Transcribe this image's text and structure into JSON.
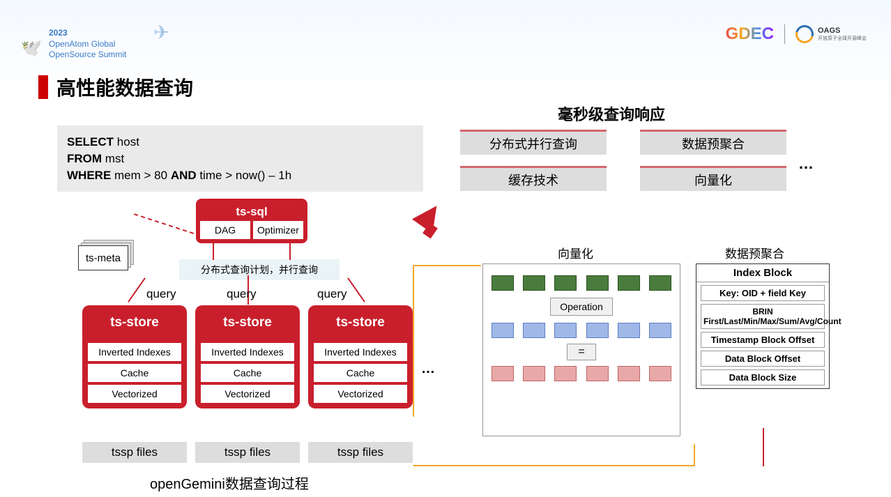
{
  "header": {
    "year": "2023",
    "line1": "OpenAtom Global",
    "line2": "OpenSource Summit"
  },
  "logos": {
    "gdec": "GDEC",
    "oags": "OAGS",
    "oags_sub": "开放原子全球开源峰会"
  },
  "title": "高性能数据查询",
  "sql": {
    "select": "SELECT",
    "select_v": "host",
    "from": "FROM",
    "from_v": "mst",
    "where": "WHERE",
    "where_v1": "mem > 80",
    "and": "AND",
    "where_v2": "time > now() – 1h"
  },
  "ms_title": "毫秒级查询响应",
  "features": [
    "分布式并行查询",
    "数据预聚合",
    "缓存技术",
    "向量化"
  ],
  "ellipsis": "…",
  "ts_sql": {
    "title": "ts-sql",
    "dag": "DAG",
    "opt": "Optimizer"
  },
  "ts_meta": "ts-meta",
  "dist_label": "分布式查询计划，并行查询",
  "query": "query",
  "ts_store": {
    "title": "ts-store",
    "inv": "Inverted Indexes",
    "cache": "Cache",
    "vec": "Vectorized"
  },
  "tssp": "tssp files",
  "bottom": "openGemini数据查询过程",
  "vec_title": "向量化",
  "agg_title": "数据预聚合",
  "operation": "Operation",
  "equals": "=",
  "index_block": {
    "title": "Index Block",
    "key": "Key: OID + field Key",
    "brin": "BRIN\nFirst/Last/Min/Max/Sum/Avg/Count",
    "ts": "Timestamp Block Offset",
    "data": "Data Block Offset",
    "size": "Data Block Size"
  }
}
